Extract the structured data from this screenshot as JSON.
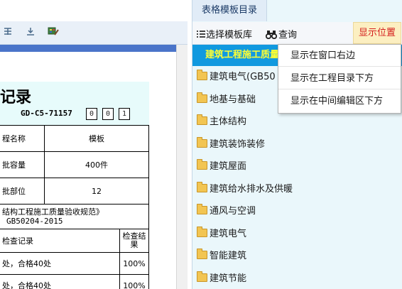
{
  "left_toolbar": {
    "icons": [
      "align-center-icon",
      "align-bottom-icon",
      "palette-icon"
    ]
  },
  "document": {
    "title": "记录",
    "code": "GD-C5-71157",
    "code_boxes": [
      "0",
      "0",
      "1"
    ],
    "rows": [
      {
        "label": "程名称",
        "value": "模板"
      },
      {
        "label": "批容量",
        "value": "400件"
      },
      {
        "label": "批部位",
        "value": "12"
      }
    ],
    "spec_line1": "结构工程施工质量验收规范》",
    "spec_line2": "GB50204-2015",
    "check_header": "检查记录",
    "check_result_header": "检查结果",
    "check_rows": [
      {
        "text": "处，合格40处",
        "value": "100%"
      },
      {
        "text": "处，合格40处",
        "value": "100%"
      }
    ]
  },
  "catalog": {
    "tab_label": "表格模板目录",
    "select_library_label": "选择模板库",
    "query_label": "查询",
    "display_position_label": "显示位置",
    "selected_item": "建筑工程施工质量",
    "items": [
      "建筑电气(GB50",
      "地基与基础",
      "主体结构",
      "建筑装饰装修",
      "建筑屋面",
      "建筑给水排水及供暖",
      "通风与空调",
      "建筑电气",
      "智能建筑",
      "建筑节能"
    ]
  },
  "position_menu": {
    "items": [
      "显示在窗口右边",
      "显示在工程目录下方",
      "显示在中间编辑区下方"
    ]
  },
  "colors": {
    "selected_bg": "#1199df",
    "selected_text": "#ffff33",
    "accent_red": "#d41c1c",
    "panel_bg": "#eaf7fb"
  }
}
